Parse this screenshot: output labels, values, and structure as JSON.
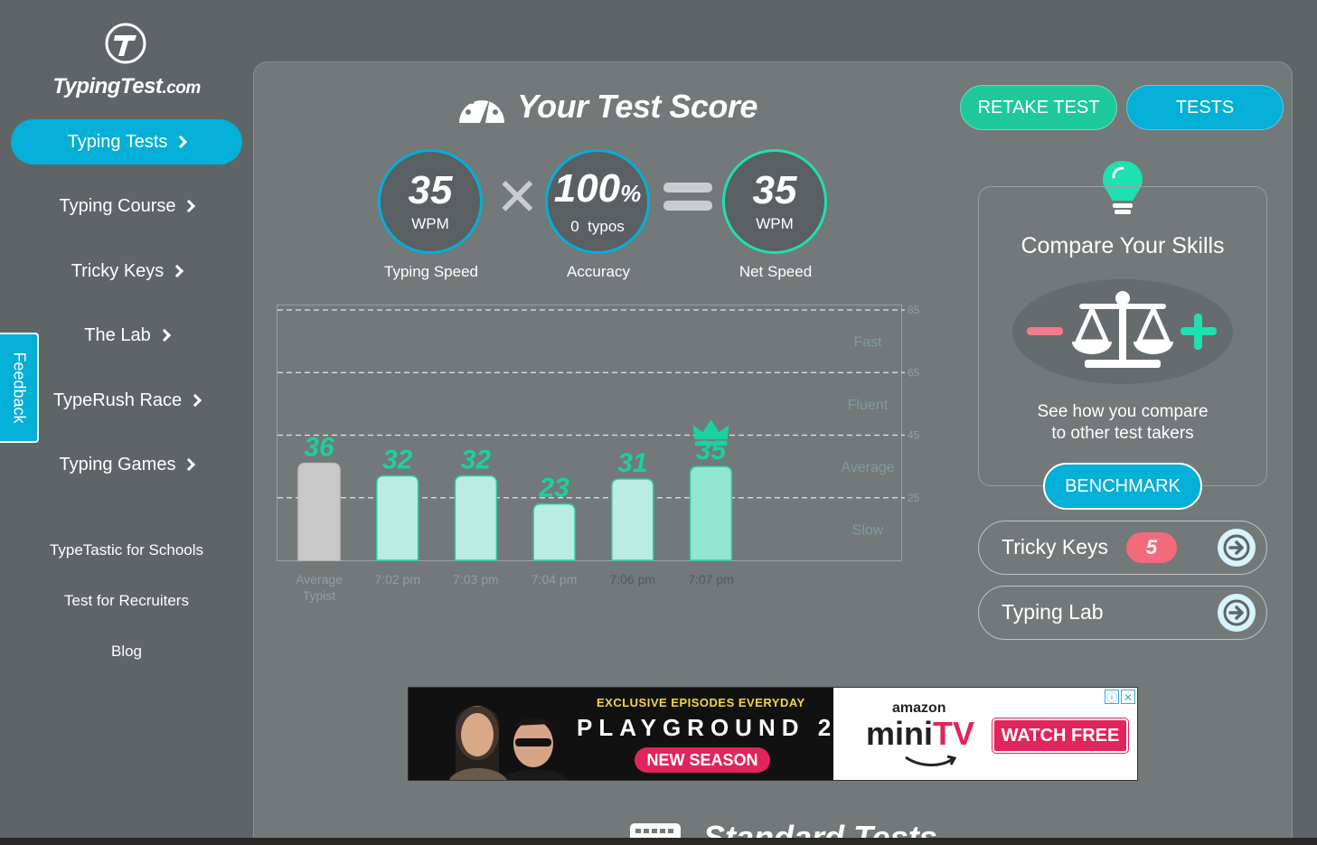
{
  "brand": {
    "name": "TypingTest",
    "domain": ".com",
    "logo_icon": "typingtest-logo-icon"
  },
  "sidebar": {
    "nav": [
      {
        "label": "Typing Tests",
        "active": true
      },
      {
        "label": "Typing Course",
        "active": false
      },
      {
        "label": "Tricky Keys",
        "active": false
      },
      {
        "label": "The Lab",
        "active": false
      },
      {
        "label": "TypeRush Race",
        "active": false
      },
      {
        "label": "Typing Games",
        "active": false
      }
    ],
    "links": [
      "TypeTastic for Schools",
      "Test for Recruiters",
      "Blog"
    ]
  },
  "feedback": {
    "label": "Feedback"
  },
  "header": {
    "title": "Your Test Score",
    "retake_label": "RETAKE TEST",
    "tests_label": "TESTS"
  },
  "score": {
    "speed": {
      "value": "35",
      "unit": "WPM",
      "caption": "Typing Speed"
    },
    "accuracy": {
      "value": "100",
      "unit_pct": "%",
      "typos_count": "0",
      "typos_label": "typos",
      "caption": "Accuracy"
    },
    "net": {
      "value": "35",
      "unit": "WPM",
      "caption": "Net Speed"
    }
  },
  "chart_data": {
    "type": "bar",
    "categories": [
      "Average Typist",
      "7:02 pm",
      "7:03 pm",
      "7:04 pm",
      "7:06 pm",
      "7:07 pm"
    ],
    "values": [
      36,
      32,
      32,
      23,
      31,
      35
    ],
    "best_index": 5,
    "ylim": [
      5,
      85
    ],
    "y_ticks": [
      85,
      65,
      45,
      25
    ],
    "bands": [
      "Fast",
      "Fluent",
      "Average",
      "Slow"
    ],
    "grid": true,
    "colors": {
      "average": "#c8c8c8",
      "bar": "#b9ede0",
      "best": "#93e6d0",
      "value_label": "#1bd19f",
      "crown": "#1bd19f"
    }
  },
  "compare": {
    "title": "Compare Your Skills",
    "text_line1": "See how you compare",
    "text_line2": "to other test takers",
    "button_label": "BENCHMARK"
  },
  "quick_links": [
    {
      "label": "Tricky Keys",
      "badge": "5"
    },
    {
      "label": "Typing Lab"
    }
  ],
  "ad": {
    "tagline": "EXCLUSIVE EPISODES EVERYDAY",
    "show": "PLAYGROUND 2",
    "season": "NEW SEASON",
    "amazon": "amazon",
    "mini": "mini",
    "tv": "TV",
    "cta": "WATCH FREE"
  },
  "section": {
    "title": "Standard Tests"
  }
}
